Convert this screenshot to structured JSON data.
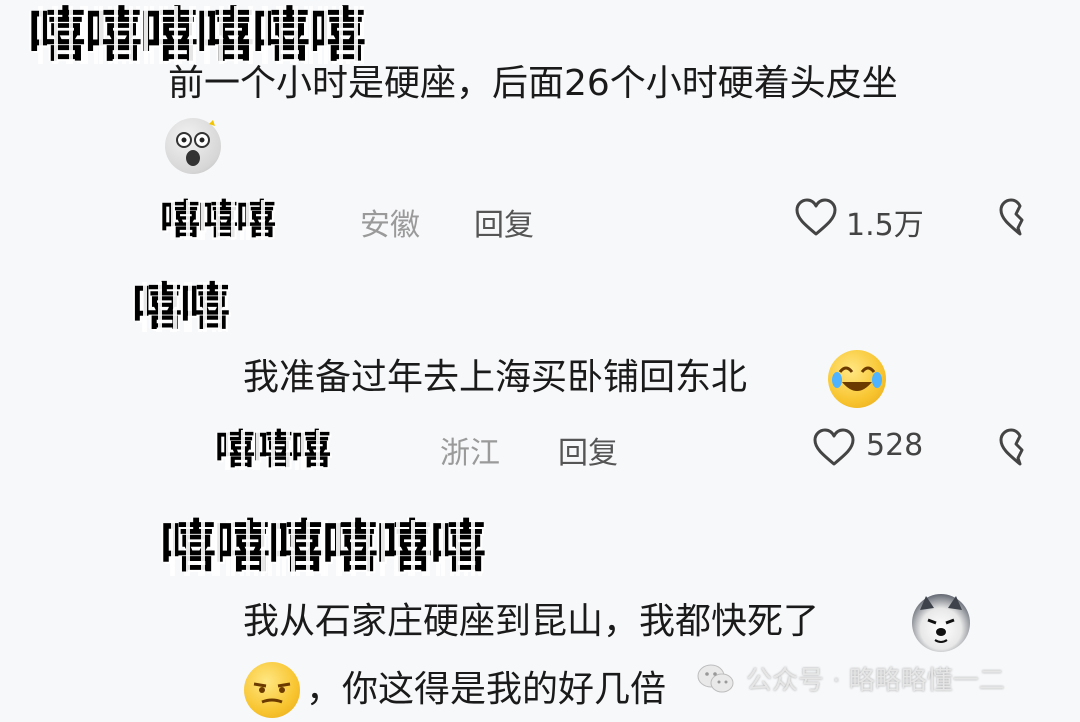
{
  "comments": [
    {
      "username": "嘻嘻嘻嘻嘻嘻",
      "text": "前一个小时是硬座，后面26个小时硬着头皮坐",
      "location": "安徽",
      "reply_label": "回复",
      "likes": "1.5万",
      "emoji": "shocked-emoji",
      "username_repeat": "嘻嘻嘻"
    },
    {
      "username": "嘻嘻",
      "text": "我准备过年去上海买卧铺回东北",
      "location": "浙江",
      "reply_label": "回复",
      "likes": "528",
      "emoji": "laugh-cry-emoji",
      "username_repeat": "嘻嘻嘻"
    },
    {
      "username": "嘻嘻嘻嘻嘻嘻",
      "text_line1": "我从石家庄硬座到昆山，我都快死了",
      "text_line2": "，你这得是我的好几倍",
      "emoji1": "husky-dog-emoji",
      "emoji2": "smirk-emoji"
    }
  ],
  "watermark": {
    "icon": "wechat-icon",
    "text": "公众号 · 略略略懂一二"
  },
  "icons": {
    "like": "heart-outline-icon",
    "dislike": "broken-heart-icon"
  }
}
